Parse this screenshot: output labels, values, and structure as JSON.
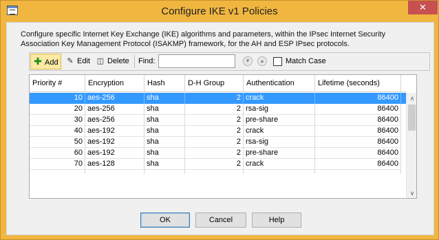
{
  "window": {
    "title": "Configure IKE v1 Policies",
    "close_label": "✕"
  },
  "description": "Configure specific Internet Key Exchange (IKE) algorithms and parameters, within the IPsec Internet Security Association Key Management Protocol (ISAKMP) framework, for the AH and ESP IPsec protocols.",
  "toolbar": {
    "add_label": "Add",
    "edit_label": "Edit",
    "delete_label": "Delete",
    "find_label": "Find:",
    "find_value": "",
    "match_case_label": "Match Case",
    "match_case_checked": false
  },
  "table": {
    "columns": [
      "Priority #",
      "Encryption",
      "Hash",
      "D-H Group",
      "Authentication",
      "Lifetime (seconds)"
    ],
    "selected_row": 0,
    "rows": [
      [
        "10",
        "aes-256",
        "sha",
        "2",
        "crack",
        "86400"
      ],
      [
        "20",
        "aes-256",
        "sha",
        "2",
        "rsa-sig",
        "86400"
      ],
      [
        "30",
        "aes-256",
        "sha",
        "2",
        "pre-share",
        "86400"
      ],
      [
        "40",
        "aes-192",
        "sha",
        "2",
        "crack",
        "86400"
      ],
      [
        "50",
        "aes-192",
        "sha",
        "2",
        "rsa-sig",
        "86400"
      ],
      [
        "60",
        "aes-192",
        "sha",
        "2",
        "pre-share",
        "86400"
      ],
      [
        "70",
        "aes-128",
        "sha",
        "2",
        "crack",
        "86400"
      ]
    ]
  },
  "buttons": {
    "ok": "OK",
    "cancel": "Cancel",
    "help": "Help"
  },
  "colors": {
    "title_bar": "#f0b640",
    "close_button": "#c75050",
    "selection": "#3399ff"
  },
  "icons": [
    "app-icon",
    "add-icon",
    "edit-icon",
    "delete-icon",
    "find-next-icon",
    "find-previous-icon",
    "scroll-up-icon",
    "scroll-down-icon"
  ]
}
